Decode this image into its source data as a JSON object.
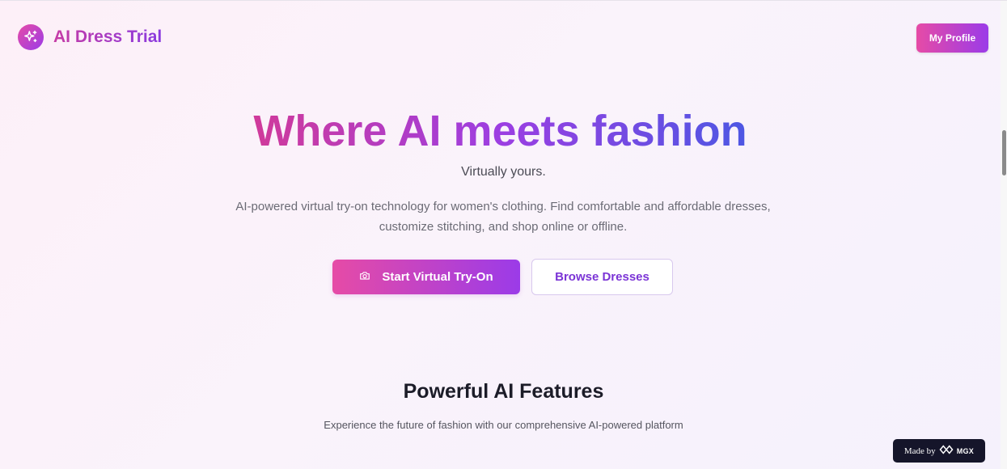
{
  "header": {
    "brand": "AI Dress Trial",
    "profile_label": "My Profile"
  },
  "hero": {
    "title": "Where AI meets fashion",
    "tagline": "Virtually yours.",
    "description": "AI-powered virtual try-on technology for women's clothing. Find comfortable and affordable dresses, customize stitching, and shop online or offline.",
    "primary_cta": "Start Virtual Try-On",
    "secondary_cta": "Browse Dresses"
  },
  "features": {
    "title": "Powerful AI Features",
    "subtitle": "Experience the future of fashion with our comprehensive AI-powered platform"
  },
  "badge": {
    "made_by": "Made by",
    "brand": "MGX"
  },
  "icons": {
    "logo": "sparkles-icon",
    "primary_cta": "camera-icon",
    "badge": "mgx-logo-icon"
  },
  "colors": {
    "accent_pink": "#e64ba6",
    "accent_purple": "#9b3be8",
    "accent_blue": "#4d57e3",
    "badge_bg": "#15152a"
  }
}
